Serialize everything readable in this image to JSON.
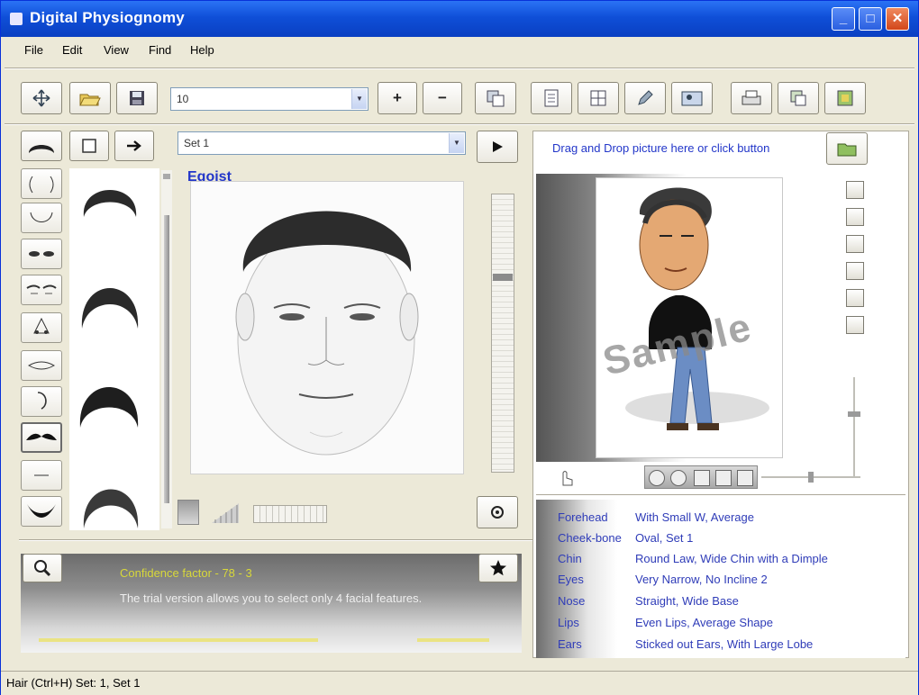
{
  "window": {
    "title": "Digital Physiognomy"
  },
  "menu": [
    "File",
    "Edit",
    "View",
    "Find",
    "Help"
  ],
  "toolbar": {
    "combo_value": "10",
    "plus_label": "+",
    "minus_label": "−"
  },
  "editor": {
    "set_combo_value": "Set 1",
    "face_name": "Egoist"
  },
  "info": {
    "line1": "Confidence factor - 78 - 3",
    "line2": "The trial version allows you to select only 4 facial features."
  },
  "photo": {
    "instruction": "Drag and Drop picture here or click button",
    "watermark": "Sample"
  },
  "attributes": [
    {
      "label": "Forehead",
      "value": "With Small W, Average"
    },
    {
      "label": "Cheek-bone",
      "value": "Oval, Set 1"
    },
    {
      "label": "Chin",
      "value": "Round Law, Wide Chin with a Dimple"
    },
    {
      "label": "Eyes",
      "value": "Very Narrow, No Incline 2"
    },
    {
      "label": "Nose",
      "value": "Straight, Wide Base"
    },
    {
      "label": "Lips",
      "value": "Even Lips, Average Shape"
    },
    {
      "label": "Ears",
      "value": "Sticked out Ears, With Large Lobe"
    }
  ],
  "status": {
    "text": "Hair (Ctrl+H) Set: 1, Set 1"
  },
  "feature_icons": [
    "hair-icon",
    "cheekbone-icon",
    "chin-icon",
    "eyes-icon",
    "eyebrows-icon",
    "nose-icon",
    "lips-icon",
    "ears-icon",
    "mustache-icon",
    "wrinkles-icon",
    "beard-icon"
  ]
}
